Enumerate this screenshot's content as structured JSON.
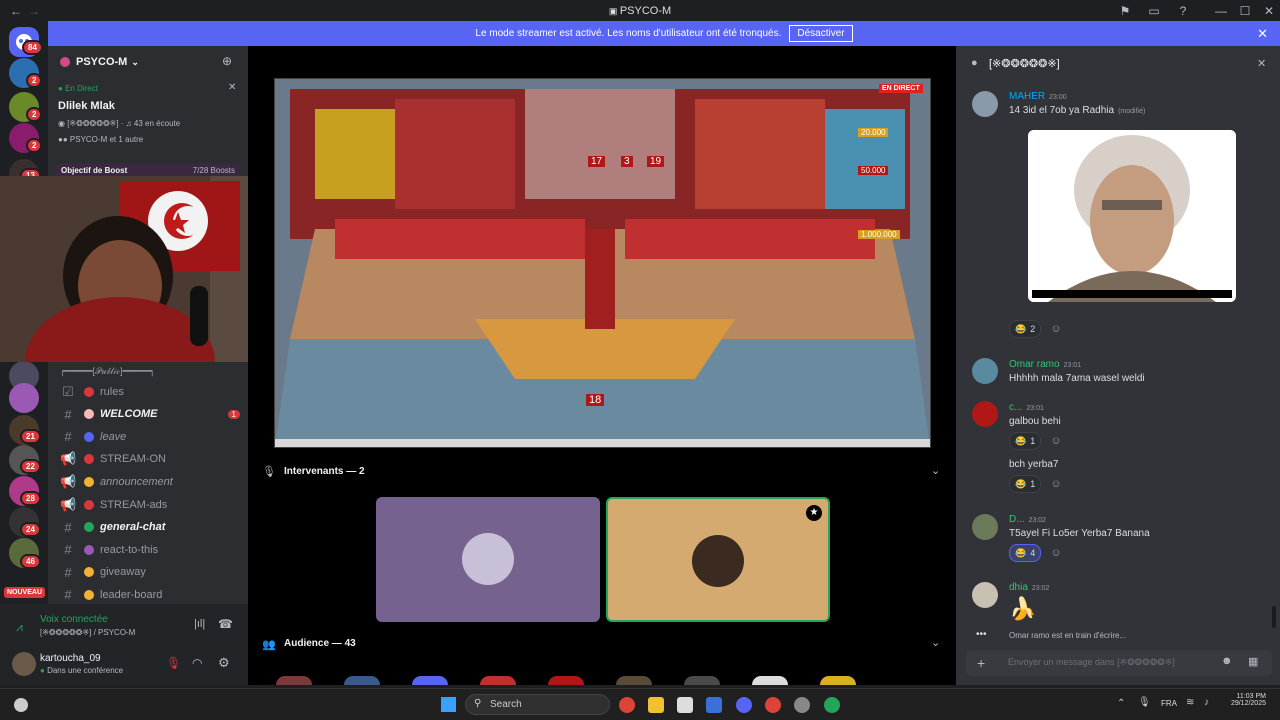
{
  "window": {
    "title": "PSYCO-M"
  },
  "banner": {
    "text": "Le mode streamer est activé. Les noms d'utilisateur ont été tronqués.",
    "button": "Désactiver"
  },
  "rail": {
    "badges": [
      "84",
      "2",
      "2",
      "2",
      "13",
      "21",
      "22",
      "28",
      "24",
      "46"
    ],
    "new_label": "NOUVEAU"
  },
  "server": {
    "name": "PSYCO-M"
  },
  "event": {
    "live_label": "En Direct",
    "title": "Dlilek Mlak",
    "listeners": "43 en écoute",
    "channel_tag": "[※❂❂❂❂❂※]",
    "joined": "PSYCO-M et 1 autre"
  },
  "boost": {
    "label": "Objectif de Boost",
    "count": "7/28 Boosts"
  },
  "category": {
    "label": "┍━━━━━[𝒫𝓊𝒷𝓁𝒾𝒸]━━━━━┑"
  },
  "channels": [
    {
      "label": "rules",
      "icon": "rules-icon",
      "color": "#da373c",
      "type": "rules"
    },
    {
      "label": "WELCOME",
      "icon": "hand-icon",
      "color": "#ffb8b8",
      "type": "text",
      "mention": "1"
    },
    {
      "label": "leave",
      "icon": "plane-icon",
      "color": "#5865f2",
      "type": "text"
    },
    {
      "label": "STREAM-ON",
      "icon": "red-circle-icon",
      "color": "#da373c",
      "type": "announce"
    },
    {
      "label": "announcement",
      "icon": "megaphone-icon",
      "color": "#f0b232",
      "type": "announce"
    },
    {
      "label": "STREAM-ads",
      "icon": "red-circle-icon",
      "color": "#da373c",
      "type": "announce"
    },
    {
      "label": "general-chat",
      "icon": "globe-icon",
      "color": "#23a55a",
      "type": "text"
    },
    {
      "label": "react-to-this",
      "icon": "grid-icon",
      "color": "#9b59b6",
      "type": "text"
    },
    {
      "label": "giveaway",
      "icon": "gift-icon",
      "color": "#f0b232",
      "type": "text"
    },
    {
      "label": "leader-board",
      "icon": "trophy-icon",
      "color": "#f0b232",
      "type": "text"
    }
  ],
  "voice": {
    "status": "Voix connectée",
    "channel": "[※❂❂❂❂❂※] / PSYCO-M"
  },
  "user": {
    "name": "kartoucha_09",
    "status": "Dans une conférence"
  },
  "stage": {
    "live_badge": "EN DIRECT",
    "speakers_label": "Intervenants — 2",
    "audience_label": "Audience — 43"
  },
  "show": {
    "prizes": [
      "20.000",
      "50.000",
      "1.000.000"
    ],
    "numbers": [
      "17",
      "3",
      "19"
    ],
    "podium": "18"
  },
  "chat": {
    "channel_name": "[※❂❂❂❂❂※]",
    "messages": [
      {
        "user": "MAHER",
        "time": "23:00",
        "text": "14 3id el 7ob ya Radhia",
        "edited": "(modifié)",
        "color": "#00a8fc"
      },
      {
        "user": "Omar ramo",
        "time": "23:01",
        "text": "Hhhhh mala 7ama wasel weldi",
        "color": "#2dc770"
      },
      {
        "user": "c...",
        "time": "23:01",
        "text": "galbou behi",
        "text2": "bch yerba7",
        "color": "#2dc770"
      },
      {
        "user": "D...",
        "time": "23:02",
        "text": "T5ayel Fi Lo5er Yerba7 Banana",
        "color": "#2dc770"
      },
      {
        "user": "dhia",
        "time": "23:02",
        "text": "🍌",
        "color": "#2dc770"
      }
    ],
    "reactions": [
      "2",
      "1",
      "1",
      "4"
    ],
    "typing": "Omar ramo est en train d'écrire...",
    "input_placeholder": "Envoyer un message dans [※❂❂❂❂❂※]"
  },
  "taskbar": {
    "search": "Search",
    "lang": "FRA",
    "time": "11:03 PM",
    "date": "29/12/2025"
  }
}
